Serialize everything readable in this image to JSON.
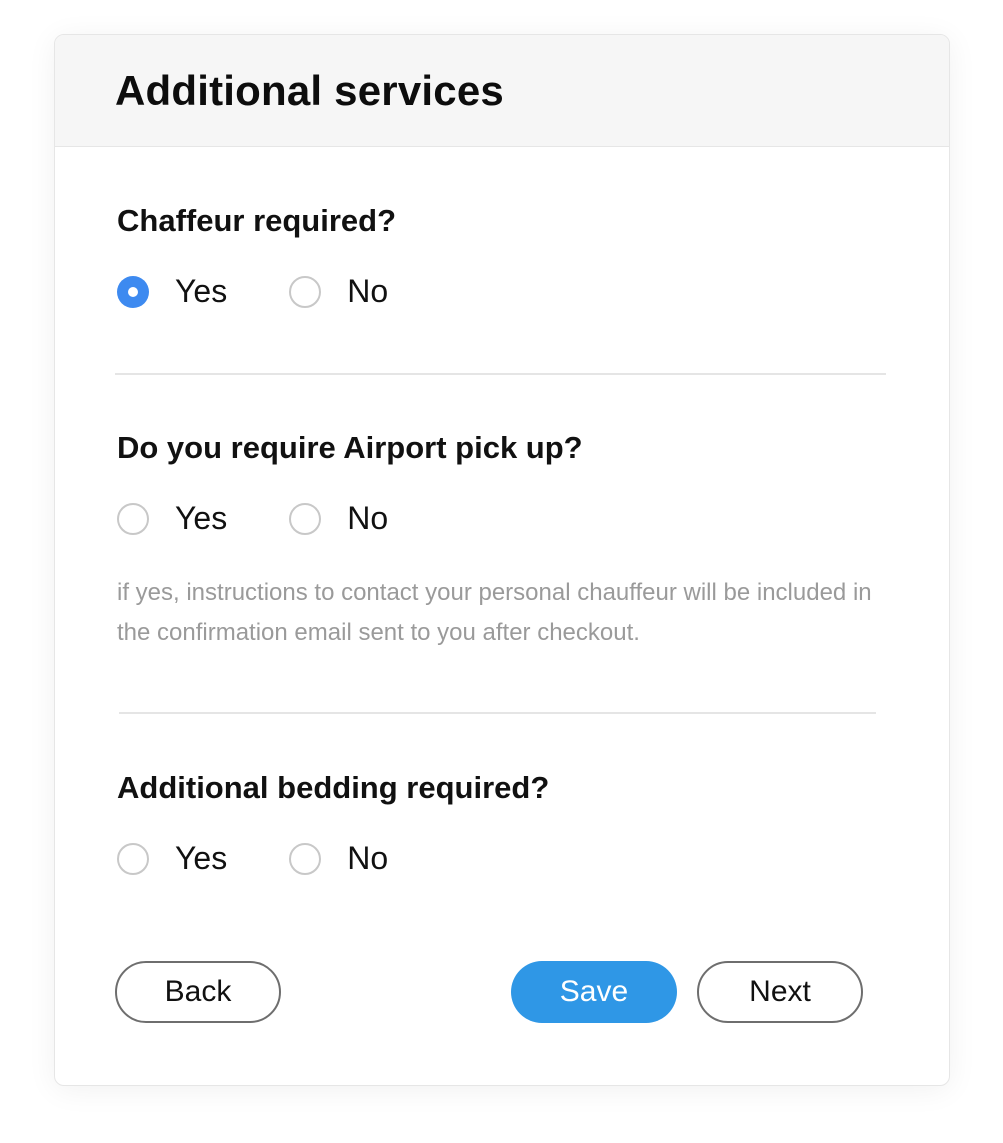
{
  "card": {
    "title": "Additional services"
  },
  "questions": [
    {
      "label": "Chaffeur required?",
      "options": [
        {
          "label": "Yes",
          "checked": true
        },
        {
          "label": "No",
          "checked": false
        }
      ]
    },
    {
      "label": "Do you require Airport pick up?",
      "options": [
        {
          "label": "Yes",
          "checked": false
        },
        {
          "label": "No",
          "checked": false
        }
      ],
      "help": "if yes, instructions to contact your personal chauffeur will be included in the confirmation email sent to you after checkout."
    },
    {
      "label": "Additional bedding required?",
      "options": [
        {
          "label": "Yes",
          "checked": false
        },
        {
          "label": "No",
          "checked": false
        }
      ]
    }
  ],
  "buttons": {
    "back": "Back",
    "save": "Save",
    "next": "Next"
  },
  "colors": {
    "accent_radio": "#3d8af0",
    "primary_button": "#2f97e6",
    "header_bg": "#f6f6f6",
    "help_text": "#9a9a9a"
  }
}
